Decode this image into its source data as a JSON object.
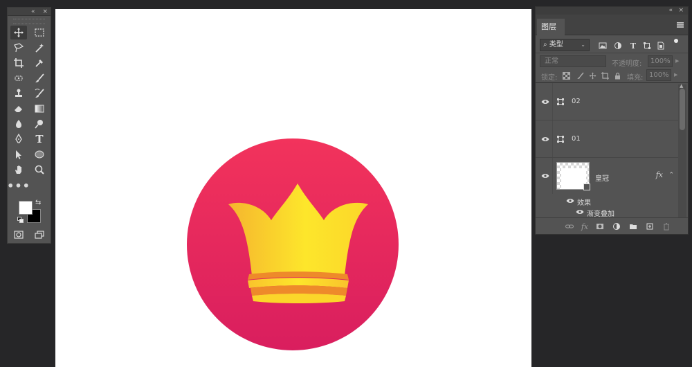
{
  "tools_panel": {
    "collapse_glyph": "«",
    "close_glyph": "×",
    "tools": [
      {
        "name": "move-tool",
        "icon": "move-icon",
        "active": true
      },
      {
        "name": "marquee-tool",
        "icon": "rect-marquee-icon"
      },
      {
        "name": "lasso-tool",
        "icon": "lasso-icon"
      },
      {
        "name": "magic-wand-tool",
        "icon": "magic-wand-icon"
      },
      {
        "name": "crop-tool",
        "icon": "crop-icon"
      },
      {
        "name": "eyedropper-tool",
        "icon": "eyedropper-icon"
      },
      {
        "name": "healing-tool",
        "icon": "healing-icon"
      },
      {
        "name": "brush-tool",
        "icon": "brush-icon"
      },
      {
        "name": "stamp-tool",
        "icon": "stamp-icon"
      },
      {
        "name": "history-brush-tool",
        "icon": "history-brush-icon"
      },
      {
        "name": "eraser-tool",
        "icon": "eraser-icon"
      },
      {
        "name": "gradient-tool",
        "icon": "gradient-icon"
      },
      {
        "name": "blur-tool",
        "icon": "blur-icon"
      },
      {
        "name": "dodge-tool",
        "icon": "dodge-icon"
      },
      {
        "name": "pen-tool",
        "icon": "pen-icon"
      },
      {
        "name": "type-tool",
        "icon": "type-icon",
        "glyph": "T"
      },
      {
        "name": "path-select-tool",
        "icon": "arrow-icon"
      },
      {
        "name": "ellipse-tool",
        "icon": "ellipse-icon"
      },
      {
        "name": "hand-tool",
        "icon": "hand-icon"
      },
      {
        "name": "zoom-tool",
        "icon": "zoom-icon"
      },
      {
        "name": "more-tools",
        "icon": "more-icon",
        "glyph": "•••"
      }
    ],
    "foreground_color": "#ffffff",
    "background_color": "#000000"
  },
  "canvas": {
    "background": "#ffffff",
    "circle_gradient": [
      "#f2335c",
      "#d91e5e"
    ],
    "crown_gradient": [
      "#f5b52e",
      "#fde62b"
    ],
    "crown_band": "#ee8a2a"
  },
  "layers_panel": {
    "collapse_glyph": "«",
    "close_glyph": "×",
    "tab_label": "图层",
    "filter": {
      "label": "类型",
      "search_glyph": "⌕"
    },
    "blend_mode": "正常",
    "opacity_label": "不透明度:",
    "opacity_value": "100%",
    "lock_label": "锁定:",
    "fill_label": "填充:",
    "fill_value": "100%",
    "layers": [
      {
        "name": "02",
        "type": "smart"
      },
      {
        "name": "01",
        "type": "smart"
      },
      {
        "name": "皇冠",
        "type": "image",
        "fx": "fx",
        "effects_label": "效果",
        "effect_item": "渐变叠加"
      }
    ]
  }
}
